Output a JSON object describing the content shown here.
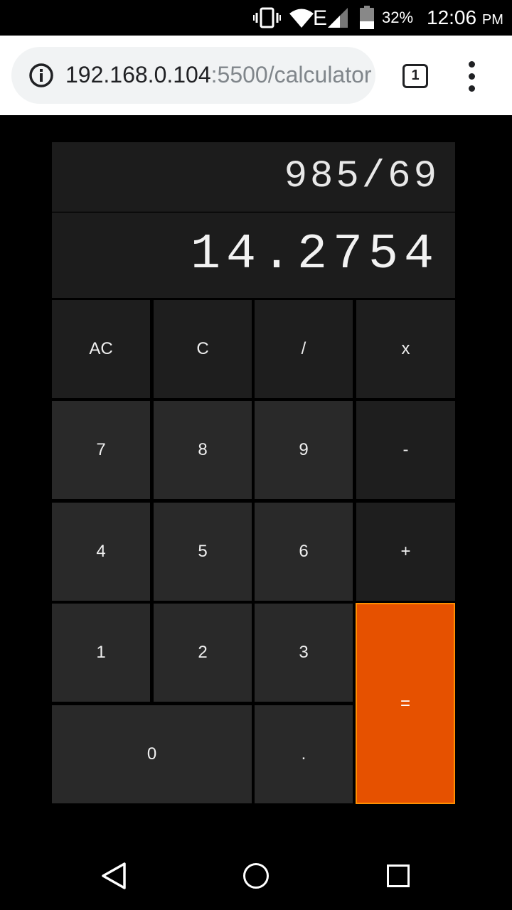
{
  "status_bar": {
    "battery_percent": "32%",
    "time": "12:06",
    "ampm": "PM",
    "network": "E",
    "icons": [
      "vibrate-icon",
      "wifi-icon",
      "signal-icon",
      "battery-icon"
    ]
  },
  "browser": {
    "url_host": "192.168.0.104",
    "url_rest": ":5500/calculator",
    "tab_count": "1",
    "icons": [
      "info-icon",
      "tabs-icon",
      "overflow-menu-icon"
    ]
  },
  "calculator": {
    "expression": "985/69",
    "result": "14.2754",
    "keys": {
      "ac": "AC",
      "c": "C",
      "divide": "/",
      "multiply": "x",
      "seven": "7",
      "eight": "8",
      "nine": "9",
      "minus": "-",
      "four": "4",
      "five": "5",
      "six": "6",
      "plus": "+",
      "one": "1",
      "two": "2",
      "three": "3",
      "equals": "=",
      "zero": "0",
      "decimal": "."
    },
    "colors": {
      "equals": "#e65100",
      "key": "#292929",
      "key_dark": "#1e1e1e",
      "display": "#1c1c1c"
    }
  },
  "nav_bar": {
    "icons": [
      "back-icon",
      "home-icon",
      "recents-icon"
    ]
  }
}
